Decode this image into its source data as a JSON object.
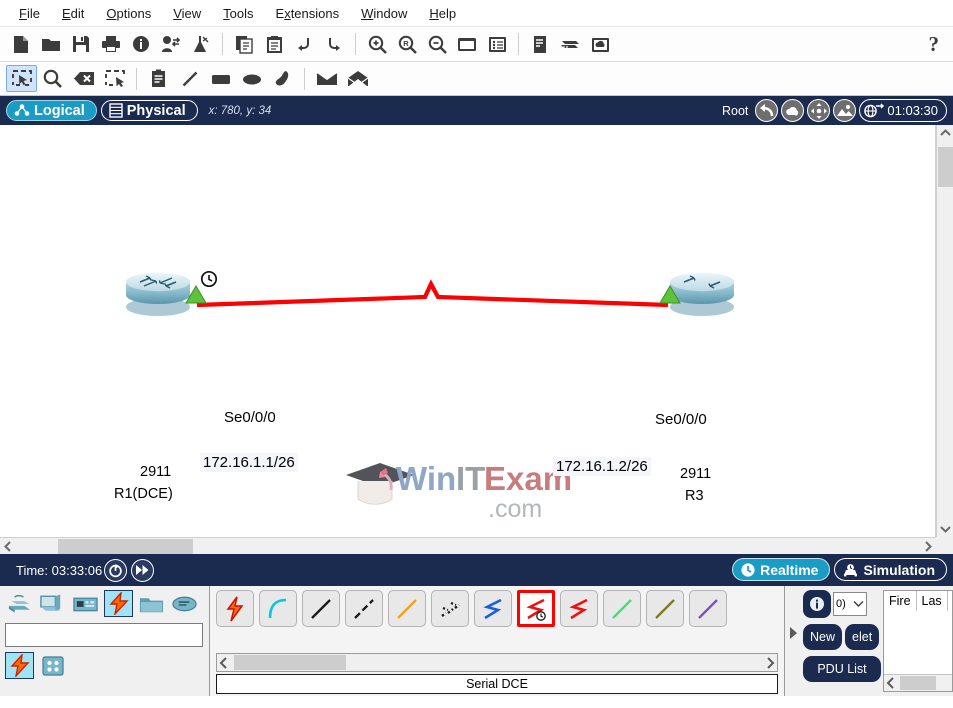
{
  "menu": {
    "items": [
      {
        "label": "File",
        "mnemonic": "F"
      },
      {
        "label": "Edit",
        "mnemonic": "E"
      },
      {
        "label": "Options",
        "mnemonic": "O"
      },
      {
        "label": "View",
        "mnemonic": "V"
      },
      {
        "label": "Tools",
        "mnemonic": "T"
      },
      {
        "label": "Extensions",
        "mnemonic": "x"
      },
      {
        "label": "Window",
        "mnemonic": "W"
      },
      {
        "label": "Help",
        "mnemonic": "H"
      }
    ]
  },
  "toolbar_main": {
    "buttons": [
      {
        "icon": "new-file-icon",
        "label": "New"
      },
      {
        "icon": "open-folder-icon",
        "label": "Open"
      },
      {
        "icon": "save-disk-icon",
        "label": "Save"
      },
      {
        "icon": "print-icon",
        "label": "Print"
      },
      {
        "icon": "activity-wizard-icon",
        "label": "Activity Wizard"
      },
      {
        "icon": "user-profile-icon",
        "label": "Network Information"
      },
      {
        "icon": "lab-flask-icon",
        "label": "Lab"
      },
      {
        "icon": "copy-icon",
        "label": "Copy"
      },
      {
        "icon": "paste-icon",
        "label": "Paste"
      },
      {
        "icon": "undo-icon",
        "label": "Undo"
      },
      {
        "icon": "redo-icon",
        "label": "Redo"
      },
      {
        "icon": "zoom-in-icon",
        "label": "Zoom In"
      },
      {
        "icon": "zoom-reset-icon",
        "label": "Zoom Reset"
      },
      {
        "icon": "zoom-out-icon",
        "label": "Zoom Out"
      },
      {
        "icon": "palette-window-icon",
        "label": "Palette"
      },
      {
        "icon": "custom-devices-icon",
        "label": "Custom Devices Dialog"
      },
      {
        "icon": "notes-panel-icon",
        "label": "Viewport"
      },
      {
        "icon": "devices-stack-icon",
        "label": "Devices"
      },
      {
        "icon": "cloud-image-icon",
        "label": "Backdrop"
      }
    ],
    "help_label": "?"
  },
  "toolbar_tools": {
    "buttons": [
      {
        "icon": "select-marquee-icon",
        "label": "Select",
        "selected": true
      },
      {
        "icon": "magnifier-icon",
        "label": "Inspect"
      },
      {
        "icon": "delete-x-icon",
        "label": "Delete"
      },
      {
        "icon": "resize-shape-icon",
        "label": "Resize Shape"
      },
      {
        "icon": "note-pad-icon",
        "label": "Place Note"
      },
      {
        "icon": "draw-line-icon",
        "label": "Draw Line"
      },
      {
        "icon": "draw-rectangle-icon",
        "label": "Draw Rectangle"
      },
      {
        "icon": "draw-ellipse-icon",
        "label": "Draw Ellipse"
      },
      {
        "icon": "draw-freeform-icon",
        "label": "Draw Freeform"
      },
      {
        "icon": "simple-pdu-icon",
        "label": "Add Simple PDU"
      },
      {
        "icon": "complex-pdu-icon",
        "label": "Add Complex PDU"
      }
    ]
  },
  "navbar": {
    "logical_label": "Logical",
    "physical_label": "Physical",
    "active_view": "Logical",
    "coordinates": "x: 780, y: 34",
    "root_label": "Root",
    "buttons": [
      {
        "icon": "back-arrow-icon",
        "label": "Back"
      },
      {
        "icon": "new-cluster-icon",
        "label": "New Cluster"
      },
      {
        "icon": "move-object-icon",
        "label": "Move Object"
      },
      {
        "icon": "set-tiled-background-icon",
        "label": "Set Tiled Background"
      },
      {
        "icon": "viewport-globe-icon",
        "label": "Viewport"
      }
    ],
    "clock_value": "01:03:30"
  },
  "topology": {
    "devices": [
      {
        "id": "r1",
        "model": "2911",
        "name": "R1(DCE)",
        "interface": "Se0/0/0",
        "ip": "172.16.1.1/26",
        "has_clock": true
      },
      {
        "id": "r3",
        "model": "2911",
        "name": "R3",
        "interface": "Se0/0/0",
        "ip": "172.16.1.2/26",
        "has_clock": false
      }
    ],
    "link": {
      "type": "Serial DCE",
      "color": "#ff0000",
      "status_left": "up",
      "status_right": "up"
    },
    "watermark": {
      "part1": "Win",
      "part2": "IT",
      "part3": "Exam",
      "part4": ".com",
      "color1": "#8fa6c4",
      "color2": "#9aa0a6",
      "color3": "#c77d7d"
    }
  },
  "timebar": {
    "time_label": "Time: 03:33:06",
    "reset_icon": "power-cycle-icon",
    "forward_icon": "fast-forward-icon",
    "realtime_label": "Realtime",
    "simulation_label": "Simulation",
    "active_mode": "Realtime"
  },
  "device_panel": {
    "categories": [
      {
        "icon": "network-devices-icon",
        "label": "Network Devices"
      },
      {
        "icon": "end-devices-icon",
        "label": "End Devices"
      },
      {
        "icon": "components-icon",
        "label": "Components"
      },
      {
        "icon": "connections-icon",
        "label": "Connections",
        "selected": true
      },
      {
        "icon": "miscellaneous-icon",
        "label": "Miscellaneous"
      },
      {
        "icon": "multiuser-icon",
        "label": "Multiuser Connection"
      }
    ],
    "search_value": "",
    "subcategories": [
      {
        "icon": "connections-bolt-icon",
        "label": "Connections",
        "selected": true
      },
      {
        "icon": "grid-tiles-icon",
        "label": "All"
      }
    ]
  },
  "connections": {
    "items": [
      {
        "icon": "automatic-cable-icon",
        "label": "Automatically Choose Connection Type",
        "color": "#ff6600"
      },
      {
        "icon": "console-cable-icon",
        "label": "Console",
        "color": "#00c8e0"
      },
      {
        "icon": "copper-straight-cable-icon",
        "label": "Copper Straight-Through",
        "color": "#1a1a1a"
      },
      {
        "icon": "copper-crossover-cable-icon",
        "label": "Copper Cross-Over",
        "color": "#1a1a1a"
      },
      {
        "icon": "fiber-cable-icon",
        "label": "Fiber",
        "color": "#f2a022"
      },
      {
        "icon": "phone-cable-icon",
        "label": "Phone",
        "color": "#1a1a1a"
      },
      {
        "icon": "coaxial-cable-icon",
        "label": "Coaxial",
        "color": "#1b5ee0"
      },
      {
        "icon": "serial-dce-cable-icon",
        "label": "Serial DCE",
        "color": "#ee1111",
        "selected": true
      },
      {
        "icon": "serial-dte-cable-icon",
        "label": "Serial DTE",
        "color": "#ee1111"
      },
      {
        "icon": "octal-cable-icon",
        "label": "Octal",
        "color": "#3ee070"
      },
      {
        "icon": "iot-custom-cable-icon",
        "label": "IoT Custom Cable",
        "color": "#7a7a22"
      },
      {
        "icon": "usb-cable-icon",
        "label": "USB",
        "color": "#7a4fc4"
      }
    ],
    "status_label": "Serial DCE"
  },
  "pdu_panel": {
    "expand_icon": "expand-arrow-icon",
    "info_icon": "info-circle-icon",
    "scenario_value": "0)",
    "new_label": "New",
    "delete_label": "elet",
    "pdu_list_label": "PDU List ",
    "table_headers": [
      "Fire",
      "Las"
    ]
  }
}
